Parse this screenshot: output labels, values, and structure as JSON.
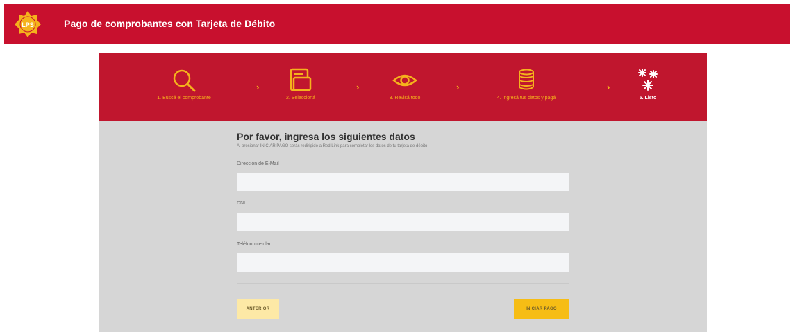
{
  "header": {
    "logo_text": "LPS",
    "title": "Pago de comprobantes con Tarjeta de Débito"
  },
  "steps": [
    {
      "label": "1. Buscá el comprobante",
      "icon": "search-icon"
    },
    {
      "label": "2. Seleccioná",
      "icon": "document-select-icon"
    },
    {
      "label": "3. Revisá todo",
      "icon": "eye-icon"
    },
    {
      "label": "4. Ingresá tus datos y pagá",
      "icon": "coins-icon"
    },
    {
      "label": "5. Listo",
      "icon": "fireworks-icon"
    }
  ],
  "step_arrow": "›",
  "form": {
    "title": "Por favor, ingresa los siguientes datos",
    "subtitle": "Al presionar INICIAR PAGO serás redirigido a Red Link para completar los datos de tu tarjeta de débito",
    "email_label": "Dirección de E-Mail",
    "email_value": "",
    "dni_label": "DNI",
    "dni_value": "",
    "phone_label": "Teléfono celular",
    "phone_value": ""
  },
  "buttons": {
    "previous": "ANTERIOR",
    "start_payment": "INICIAR PAGO"
  },
  "colors": {
    "header_red": "#c8102e",
    "steps_red": "#c0162e",
    "accent_yellow": "#f5b21c",
    "panel_grey": "#d6d6d6"
  }
}
